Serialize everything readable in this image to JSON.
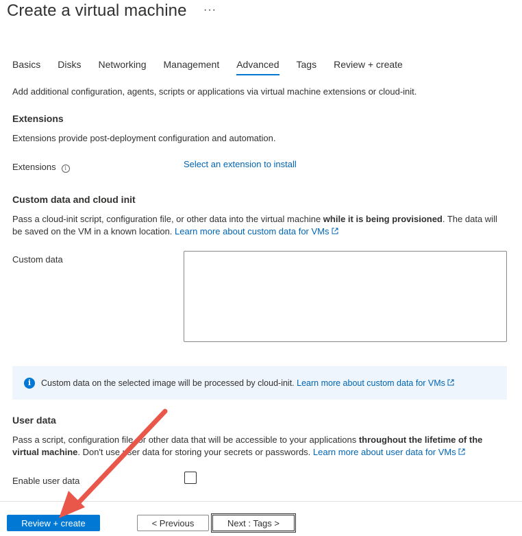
{
  "header": {
    "title": "Create a virtual machine",
    "more": "···"
  },
  "tabs": [
    {
      "label": "Basics"
    },
    {
      "label": "Disks"
    },
    {
      "label": "Networking"
    },
    {
      "label": "Management"
    },
    {
      "label": "Advanced",
      "active": true
    },
    {
      "label": "Tags"
    },
    {
      "label": "Review + create"
    }
  ],
  "intro": "Add additional configuration, agents, scripts or applications via virtual machine extensions or cloud-init.",
  "extensions": {
    "heading": "Extensions",
    "description": "Extensions provide post-deployment configuration and automation.",
    "field_label": "Extensions",
    "select_link": "Select an extension to install"
  },
  "custom_data": {
    "heading": "Custom data and cloud init",
    "desc_part1": "Pass a cloud-init script, configuration file, or other data into the virtual machine ",
    "desc_bold": "while it is being provisioned",
    "desc_part2": ". The data will be saved on the VM in a known location. ",
    "learn_link": "Learn more about custom data for VMs",
    "field_label": "Custom data",
    "value": ""
  },
  "info_bar": {
    "text": "Custom data on the selected image will be processed by cloud-init. ",
    "link": "Learn more about custom data for VMs"
  },
  "user_data": {
    "heading": "User data",
    "desc_part1": "Pass a script, configuration file, or other data that will be accessible to your applications ",
    "desc_bold": "throughout the lifetime of the virtual machine",
    "desc_part2": ". Don't use user data for storing your secrets or passwords. ",
    "learn_link": "Learn more about user data for VMs",
    "field_label": "Enable user data",
    "enabled": false
  },
  "footer": {
    "review_button": "Review + create",
    "previous_button": "< Previous",
    "next_button": "Next : Tags >"
  },
  "colors": {
    "accent": "#0078d4",
    "link": "#0064b4",
    "annotation_arrow": "#e8574a"
  }
}
